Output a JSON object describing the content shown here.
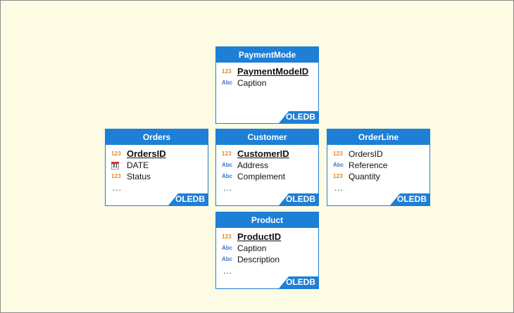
{
  "badge_color": "#1e7fd6",
  "tables": {
    "paymentmode": {
      "title": "PaymentMode",
      "badge": "OLEDB",
      "fields": [
        {
          "type": "123",
          "name": "PaymentModeID",
          "key": true
        },
        {
          "type": "Abc",
          "name": "Caption",
          "key": false
        }
      ]
    },
    "orders": {
      "title": "Orders",
      "badge": "OLEDB",
      "fields": [
        {
          "type": "123",
          "name": "OrdersID",
          "key": true
        },
        {
          "type": "31",
          "name": "DATE",
          "key": false
        },
        {
          "type": "123",
          "name": "Status",
          "key": false
        }
      ],
      "more": "..."
    },
    "customer": {
      "title": "Customer",
      "badge": "OLEDB",
      "fields": [
        {
          "type": "123",
          "name": "CustomerID",
          "key": true
        },
        {
          "type": "Abc",
          "name": "Address",
          "key": false
        },
        {
          "type": "Abc",
          "name": "Complement",
          "key": false
        }
      ],
      "more": "..."
    },
    "orderline": {
      "title": "OrderLine",
      "badge": "OLEDB",
      "fields": [
        {
          "type": "123",
          "name": "OrdersID",
          "key": false
        },
        {
          "type": "Abc",
          "name": "Reference",
          "key": false
        },
        {
          "type": "123",
          "name": "Quantity",
          "key": false
        }
      ],
      "more": "..."
    },
    "product": {
      "title": "Product",
      "badge": "OLEDB",
      "fields": [
        {
          "type": "123",
          "name": "ProductID",
          "key": true
        },
        {
          "type": "Abc",
          "name": "Caption",
          "key": false
        },
        {
          "type": "Abc",
          "name": "Description",
          "key": false
        }
      ],
      "more": "..."
    }
  }
}
